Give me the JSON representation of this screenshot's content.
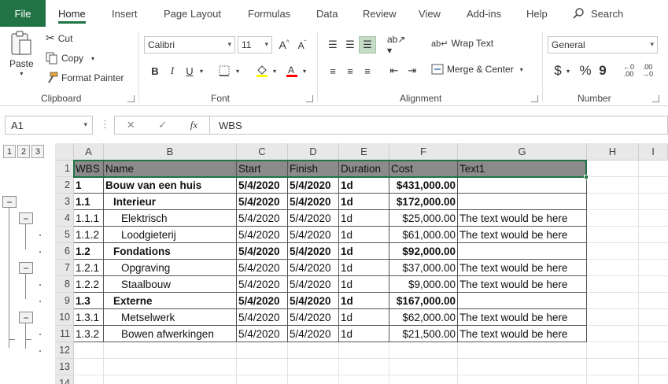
{
  "tabs": {
    "file": "File",
    "home": "Home",
    "insert": "Insert",
    "page_layout": "Page Layout",
    "formulas": "Formulas",
    "data": "Data",
    "review": "Review",
    "view": "View",
    "addins": "Add-ins",
    "help": "Help",
    "search": "Search"
  },
  "clipboard": {
    "paste": "Paste",
    "cut": "Cut",
    "copy": "Copy",
    "format_painter": "Format Painter",
    "label": "Clipboard"
  },
  "font": {
    "name": "Calibri",
    "size": "11",
    "bold": "B",
    "italic": "I",
    "underline": "U",
    "label": "Font"
  },
  "alignment": {
    "wrap_text": "Wrap Text",
    "merge_center": "Merge & Center",
    "label": "Alignment"
  },
  "number": {
    "format": "General",
    "currency": "$",
    "percent": "%",
    "comma": "9",
    "label": "Number"
  },
  "formula_bar": {
    "name_box": "A1",
    "content": "WBS",
    "fx": "fx"
  },
  "outline_levels": [
    "1",
    "2",
    "3"
  ],
  "columns": [
    "A",
    "B",
    "C",
    "D",
    "E",
    "F",
    "G",
    "H",
    "I"
  ],
  "row_numbers": [
    "1",
    "2",
    "3",
    "4",
    "5",
    "6",
    "7",
    "8",
    "9",
    "10",
    "11",
    "12",
    "13",
    "14"
  ],
  "header_row": [
    "WBS",
    "Name",
    "Start",
    "Finish",
    "Duration",
    "Cost",
    "Text1"
  ],
  "rows": [
    {
      "wbs": "1",
      "name": "Bouw van een huis",
      "start": "5/4/2020",
      "finish": "5/4/2020",
      "duration": "1d",
      "cost": "$431,000.00",
      "text1": "",
      "bold": true,
      "indent": 0
    },
    {
      "wbs": "1.1",
      "name": "Interieur",
      "start": "5/4/2020",
      "finish": "5/4/2020",
      "duration": "1d",
      "cost": "$172,000.00",
      "text1": "",
      "bold": true,
      "indent": 1
    },
    {
      "wbs": "1.1.1",
      "name": "Elektrisch",
      "start": "5/4/2020",
      "finish": "5/4/2020",
      "duration": "1d",
      "cost": "$25,000.00",
      "text1": "The text would be here",
      "bold": false,
      "indent": 2
    },
    {
      "wbs": "1.1.2",
      "name": "Loodgieterij",
      "start": "5/4/2020",
      "finish": "5/4/2020",
      "duration": "1d",
      "cost": "$61,000.00",
      "text1": "The text would be here",
      "bold": false,
      "indent": 2
    },
    {
      "wbs": "1.2",
      "name": "Fondations",
      "start": "5/4/2020",
      "finish": "5/4/2020",
      "duration": "1d",
      "cost": "$92,000.00",
      "text1": "",
      "bold": true,
      "indent": 1
    },
    {
      "wbs": "1.2.1",
      "name": "Opgraving",
      "start": "5/4/2020",
      "finish": "5/4/2020",
      "duration": "1d",
      "cost": "$37,000.00",
      "text1": "The text would be here",
      "bold": false,
      "indent": 2
    },
    {
      "wbs": "1.2.2",
      "name": "Staalbouw",
      "start": "5/4/2020",
      "finish": "5/4/2020",
      "duration": "1d",
      "cost": "$9,000.00",
      "text1": "The text would be here",
      "bold": false,
      "indent": 2
    },
    {
      "wbs": "1.3",
      "name": "Externe",
      "start": "5/4/2020",
      "finish": "5/4/2020",
      "duration": "1d",
      "cost": "$167,000.00",
      "text1": "",
      "bold": true,
      "indent": 1
    },
    {
      "wbs": "1.3.1",
      "name": "Metselwerk",
      "start": "5/4/2020",
      "finish": "5/4/2020",
      "duration": "1d",
      "cost": "$62,000.00",
      "text1": "The text would be here",
      "bold": false,
      "indent": 2
    },
    {
      "wbs": "1.3.2",
      "name": "Bowen afwerkingen",
      "start": "5/4/2020",
      "finish": "5/4/2020",
      "duration": "1d",
      "cost": "$21,500.00",
      "text1": "The text would be here",
      "bold": false,
      "indent": 2
    }
  ],
  "colors": {
    "accent": "#217346",
    "header_fill": "#8b8b8b",
    "selection": "#217346"
  }
}
